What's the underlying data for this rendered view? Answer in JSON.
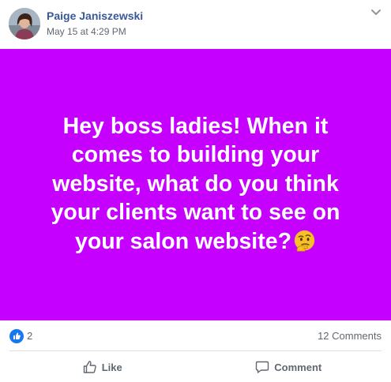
{
  "post": {
    "author": "Paige Janiszewski",
    "timestamp": "May 15 at 4:29 PM",
    "text": "Hey boss ladies! When it comes to building your website, what do you think your clients want to see on your salon website?",
    "background_color": "#c600ff",
    "emoji_icon": "thinking-face-icon"
  },
  "stats": {
    "reaction_icon": "like-reaction-icon",
    "reaction_count": "2",
    "comment_count": "12 Comments"
  },
  "actions": {
    "like_label": "Like",
    "comment_label": "Comment"
  }
}
